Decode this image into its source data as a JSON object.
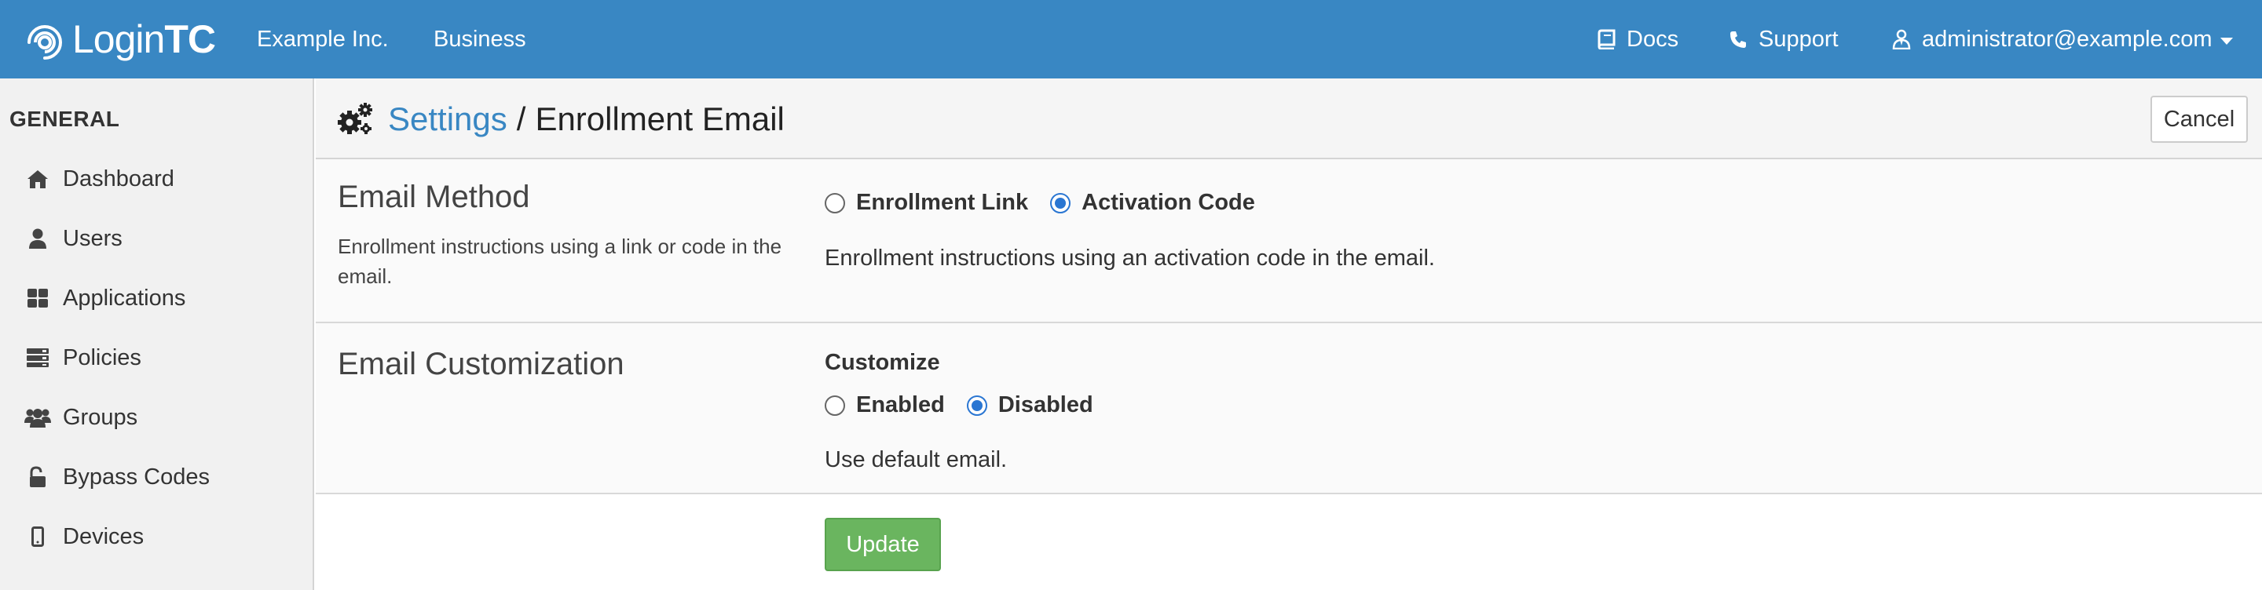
{
  "brand": {
    "logo_prefix": "Login",
    "logo_suffix": "TC"
  },
  "navbar": {
    "org": "Example Inc.",
    "plan": "Business",
    "docs": "Docs",
    "support": "Support",
    "user": "administrator@example.com",
    "bg_color": "#3987c3"
  },
  "sidebar": {
    "heading": "GENERAL",
    "items": [
      {
        "label": "Dashboard",
        "icon": "home-icon"
      },
      {
        "label": "Users",
        "icon": "user-icon"
      },
      {
        "label": "Applications",
        "icon": "grid-icon"
      },
      {
        "label": "Policies",
        "icon": "server-icon"
      },
      {
        "label": "Groups",
        "icon": "users-icon"
      },
      {
        "label": "Bypass Codes",
        "icon": "unlock-icon"
      },
      {
        "label": "Devices",
        "icon": "mobile-icon"
      }
    ]
  },
  "header": {
    "crumb": "Settings",
    "separator": "/",
    "title": "Enrollment Email",
    "cancel": "Cancel"
  },
  "email_method": {
    "title": "Email Method",
    "description": "Enrollment instructions using a link or code in the email.",
    "options": [
      "Enrollment Link",
      "Activation Code"
    ],
    "selected": "Activation Code",
    "help": "Enrollment instructions using an activation code in the email."
  },
  "email_customization": {
    "title": "Email Customization",
    "field_label": "Customize",
    "options": [
      "Enabled",
      "Disabled"
    ],
    "selected": "Disabled",
    "help": "Use default email."
  },
  "actions": {
    "update": "Update",
    "update_color": "#6ab55f"
  }
}
